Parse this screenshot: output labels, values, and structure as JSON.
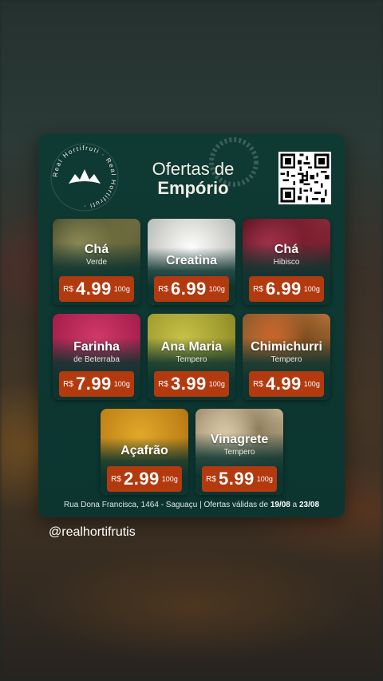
{
  "brand": {
    "seal_text": "Real Hortifruti · Real Hortifruti ·"
  },
  "header": {
    "title_line1": "Ofertas de",
    "title_line2": "Empório"
  },
  "currency": "R$",
  "unit": "100g",
  "products": [
    {
      "name": "Chá",
      "subtitle": "Verde",
      "price": "4.99"
    },
    {
      "name": "Creatina",
      "subtitle": "",
      "price": "6.99"
    },
    {
      "name": "Chá",
      "subtitle": "Hibisco",
      "price": "6.99"
    },
    {
      "name": "Farinha",
      "subtitle": "de Beterraba",
      "price": "7.99"
    },
    {
      "name": "Ana Maria",
      "subtitle": "Tempero",
      "price": "3.99"
    },
    {
      "name": "Chimichurri",
      "subtitle": "Tempero",
      "price": "4.99"
    },
    {
      "name": "Açafrão",
      "subtitle": "",
      "price": "2.99"
    },
    {
      "name": "Vinagrete",
      "subtitle": "Tempero",
      "price": "5.99"
    }
  ],
  "footer": {
    "address": "Rua Dona Francisca, 1464 - Saguaçu | Ofertas válidas de ",
    "date_from": "19/08",
    "connector": " a ",
    "date_to": "23/08"
  },
  "story": {
    "handle": "@realhortifrutis"
  },
  "colors": {
    "card": "#0c3530",
    "price_tag": "#b3390e",
    "text": "#ffffff"
  }
}
